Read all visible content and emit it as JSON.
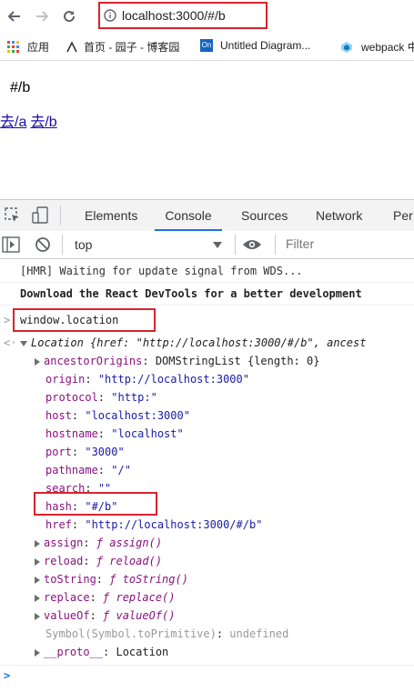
{
  "browser": {
    "url": "localhost:3000/#/b",
    "bookmarks": [
      {
        "label": "应用"
      },
      {
        "label": "首页 - 园子 - 博客园"
      },
      {
        "label": "Untitled Diagram..."
      },
      {
        "label": "webpack 中"
      }
    ]
  },
  "page": {
    "route_text": "#/b",
    "link_a": "去/a",
    "link_b": "去/b"
  },
  "devtools": {
    "tabs": [
      "Elements",
      "Console",
      "Sources",
      "Network",
      "Per"
    ],
    "active_tab": "Console",
    "context": "top",
    "filter_placeholder": "Filter"
  },
  "console": {
    "hmr_msg": "[HMR] Waiting for update signal from WDS...",
    "react_msg": "Download the React DevTools for a better development",
    "input": "window.location",
    "location_header": "Location {href: \"http://localhost:3000/#/b\", ancest",
    "props": [
      {
        "key": "ancestorOrigins",
        "value": "DOMStringList {length: 0}",
        "expandable": true
      },
      {
        "key": "origin",
        "value": "\"http://localhost:3000\""
      },
      {
        "key": "protocol",
        "value": "\"http:\""
      },
      {
        "key": "host",
        "value": "\"localhost:3000\""
      },
      {
        "key": "hostname",
        "value": "\"localhost\""
      },
      {
        "key": "port",
        "value": "\"3000\""
      },
      {
        "key": "pathname",
        "value": "\"/\""
      },
      {
        "key": "search",
        "value": "\"\""
      },
      {
        "key": "hash",
        "value": "\"#/b\""
      },
      {
        "key": "href",
        "value": "\"http://localhost:3000/#/b\""
      },
      {
        "key": "assign",
        "value": "ƒ assign()",
        "expandable": true
      },
      {
        "key": "reload",
        "value": "ƒ reload()",
        "expandable": true
      },
      {
        "key": "toString",
        "value": "ƒ toString()",
        "expandable": true
      },
      {
        "key": "replace",
        "value": "ƒ replace()",
        "expandable": true
      },
      {
        "key": "valueOf",
        "value": "ƒ valueOf()",
        "expandable": true
      },
      {
        "key": "Symbol(Symbol.toPrimitive)",
        "value": "undefined"
      },
      {
        "key": "__proto__",
        "value": "Location",
        "expandable": true
      }
    ]
  }
}
